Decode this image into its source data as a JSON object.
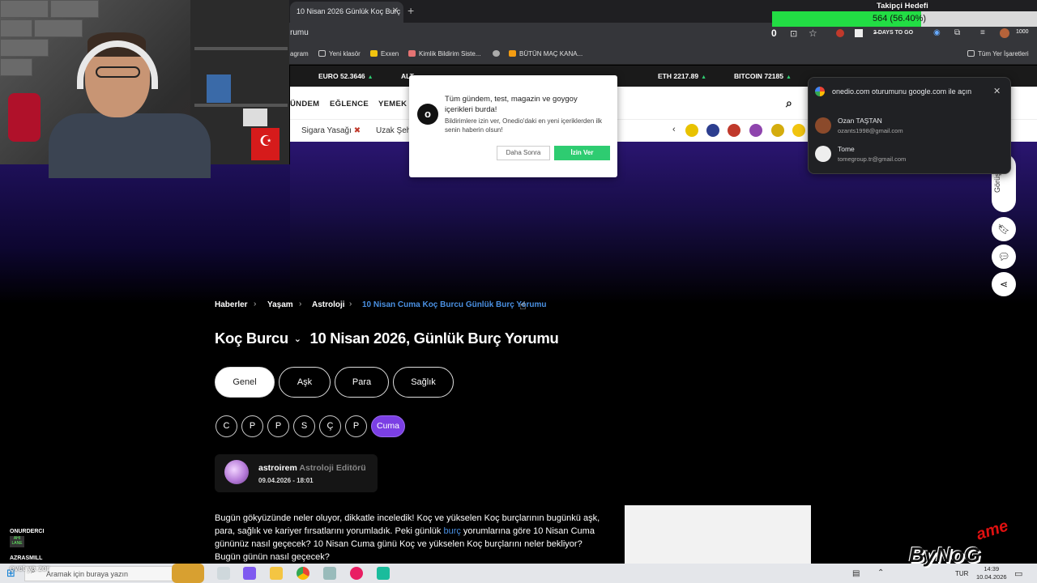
{
  "browser": {
    "tab_title": "10 Nisan 2026 Günlük Koç Burç",
    "url": "rumu",
    "bookmarks": [
      "agram",
      "Yeni klasör",
      "Exxen",
      "Kimlik Bildirim Siste...",
      "BÜTÜN MAÇ KANA...",
      "Tüm Yer İşaretleri"
    ],
    "ext_counter": "1000",
    "ext_days": "2̶̶ DAYS TO GO"
  },
  "ticker": [
    {
      "label": "EURO",
      "value": "52.3646"
    },
    {
      "label": "ALT",
      "value": "..."
    },
    {
      "label": "ETH",
      "value": "2217.89"
    },
    {
      "label": "BITCOIN",
      "value": "72185"
    }
  ],
  "nav": {
    "items": [
      "ÜNDEM",
      "EĞLENCE",
      "YEMEK"
    ],
    "sub_items": [
      "Sigara Yasağı",
      "Uzak Şeh"
    ]
  },
  "breadcrumb": {
    "items": [
      "Haberler",
      "Yaşam",
      "Astroloji"
    ],
    "current": "10 Nisan Cuma Koç Burcu Günlük Burç Yorumu"
  },
  "article": {
    "sign": "Koç Burcu",
    "title": "10 Nisan 2026, Günlük Burç Yorumu",
    "tabs": [
      "Genel",
      "Aşk",
      "Para",
      "Sağlık"
    ],
    "days": [
      "C",
      "P",
      "P",
      "S",
      "Ç",
      "P"
    ],
    "today": "Cuma",
    "author": "astroirem",
    "author_role": "Astroloji Editörü",
    "date": "09.04.2026 - 18:01",
    "body_1": "Bugün gökyüzünde neler oluyor, dikkatle inceledik! Koç ve yükselen Koç burçlarının bugünkü aşk, para, sağlık ve kariyer fırsatlarını yorumladık. Peki günlük ",
    "body_link": "burç",
    "body_2": " yorumlarına göre 10 Nisan Cuma gününüz nasıl geçecek? 10 Nisan Cuma günü Koç ve yükselen Koç burçlarını neler bekliyor? Bugün günün nasıl geçecek?"
  },
  "side": {
    "pill_text": "Görüş Bi"
  },
  "notification": {
    "title": "Tüm gündem, test, magazin ve goygoy içerikleri burda!",
    "text": "Bildirimlere izin ver, Onedio'daki en yeni içeriklerden ilk senin haberin olsun!",
    "later": "Daha Sonra",
    "allow": "İzin Ver"
  },
  "google": {
    "title": "onedio.com oturumunu google.com ile açın",
    "accounts": [
      {
        "name": "Ozan TAŞTAN",
        "email": "ozants1998@gmail.com"
      },
      {
        "name": "Tome",
        "email": "tomegroup.tr@gmail.com"
      }
    ]
  },
  "stream": {
    "goal_title": "Takipçi Hedefi",
    "goal_text": "564 (56.40%)",
    "goal_fraction": 0.564,
    "counter": "0",
    "chat": [
      {
        "user": "ONURDERCI",
        "badge": "AHI LANE"
      },
      {
        "user": "AZRASMILL",
        "badge": ""
      }
    ],
    "chat_msg": "evet ya zor",
    "logo_text": "ByNoG",
    "logo_game": "ame"
  },
  "taskbar": {
    "search": "Aramak için buraya yazın",
    "lang": "TUR",
    "time": "14:39",
    "date": "10.04.2026"
  },
  "colors": {
    "accent": "#7b3fe4",
    "link": "#4a90e2",
    "allow_green": "#2ecc71",
    "goal_green": "#22dd44"
  }
}
